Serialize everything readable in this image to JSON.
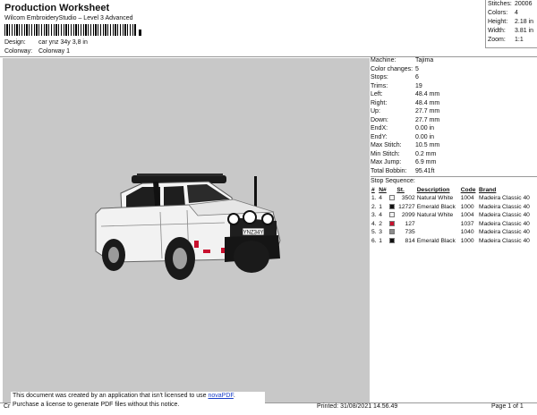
{
  "header": {
    "title": "Production Worksheet",
    "subtitle": "Wilcom EmbroideryStudio – Level 3 Advanced",
    "design_label": "Design:",
    "design_value": "car ynz 34y 3,8 in",
    "colorway_label": "Colorway:",
    "colorway_value": "Colorway 1"
  },
  "stats": [
    {
      "label": "Stitches:",
      "value": "20006"
    },
    {
      "label": "Colors:",
      "value": "4"
    },
    {
      "label": "Height:",
      "value": "2.18 in"
    },
    {
      "label": "Width:",
      "value": "3.81 in"
    },
    {
      "label": "Zoom:",
      "value": "1:1"
    }
  ],
  "design_image": {
    "plate_text": "YNZ34Y",
    "canvas_color": "#c8c8c8"
  },
  "machine_info": [
    {
      "label": "Machine:",
      "value": "Tajima"
    },
    {
      "label": "Color changes:",
      "value": "5"
    },
    {
      "label": "Stops:",
      "value": "6"
    },
    {
      "label": "Trims:",
      "value": "19"
    },
    {
      "label": "Left:",
      "value": "48.4 mm"
    },
    {
      "label": "Right:",
      "value": "48.4 mm"
    },
    {
      "label": "Up:",
      "value": "27.7 mm"
    },
    {
      "label": "Down:",
      "value": "27.7 mm"
    },
    {
      "label": "EndX:",
      "value": "0.00 in"
    },
    {
      "label": "EndY:",
      "value": "0.00 in"
    },
    {
      "label": "Max Stitch:",
      "value": "10.5 mm"
    },
    {
      "label": "Min Stitch:",
      "value": "0.2 mm"
    },
    {
      "label": "Max Jump:",
      "value": "6.9 mm"
    },
    {
      "label": "Total Bobbin:",
      "value": "95.41ft"
    }
  ],
  "stop_sequence": {
    "title": "Stop Sequence:",
    "columns": [
      "#",
      "N#",
      "",
      "St.",
      "Description",
      "Code",
      "Brand"
    ],
    "rows": [
      {
        "num": "1.",
        "needle": "4",
        "color": "#f2f2f2",
        "stitches": "3502",
        "description": "Natural White",
        "code": "1004",
        "brand": "Madeira Classic 40"
      },
      {
        "num": "2.",
        "needle": "1",
        "color": "#111111",
        "stitches": "12727",
        "description": "Emerald Black",
        "code": "1000",
        "brand": "Madeira Classic 40"
      },
      {
        "num": "3.",
        "needle": "4",
        "color": "#f2f2f2",
        "stitches": "2099",
        "description": "Natural White",
        "code": "1004",
        "brand": "Madeira Classic 40"
      },
      {
        "num": "4.",
        "needle": "2",
        "color": "#c8102e",
        "stitches": "127",
        "description": "",
        "code": "1037",
        "brand": "Madeira Classic 40"
      },
      {
        "num": "5.",
        "needle": "3",
        "color": "#8c8c8c",
        "stitches": "735",
        "description": "",
        "code": "1040",
        "brand": "Madeira Classic 40"
      },
      {
        "num": "6.",
        "needle": "1",
        "color": "#111111",
        "stitches": "814",
        "description": "Emerald Black",
        "code": "1000",
        "brand": "Madeira Classic 40"
      }
    ]
  },
  "footer": {
    "notice_line1": "This document was created by an application that isn't licensed to use ",
    "notice_link": "novaPDF",
    "notice_line1_end": ".",
    "notice_line2": "Purchase a license to generate PDF files without this notice.",
    "cr": "Cr",
    "printed": "Printed: 31/08/2021 14.56.49",
    "page": "Page 1 of 1"
  }
}
